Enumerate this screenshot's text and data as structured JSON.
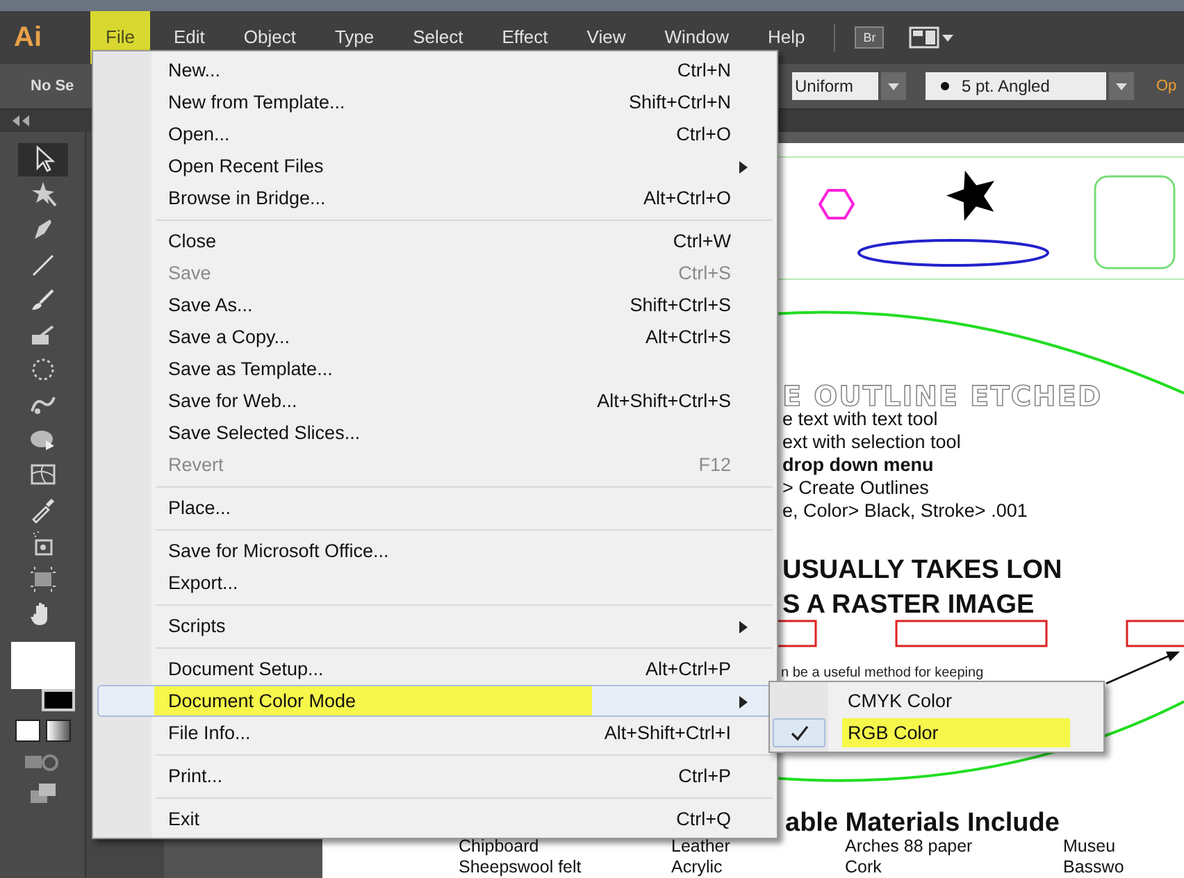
{
  "app": {
    "logo": "Ai"
  },
  "menubar": [
    {
      "label": "File",
      "selected": true
    },
    {
      "label": "Edit",
      "selected": false
    },
    {
      "label": "Object",
      "selected": false
    },
    {
      "label": "Type",
      "selected": false
    },
    {
      "label": "Select",
      "selected": false
    },
    {
      "label": "Effect",
      "selected": false
    },
    {
      "label": "View",
      "selected": false
    },
    {
      "label": "Window",
      "selected": false
    },
    {
      "label": "Help",
      "selected": false
    }
  ],
  "bridge_button": {
    "label": "Br"
  },
  "control_bar": {
    "selection": "No Se",
    "stroke_profile": "Uniform",
    "brush": "5 pt. Angled",
    "opacity_link": "Op"
  },
  "file_menu": {
    "groups": [
      [
        {
          "label": "New...",
          "shortcut": "Ctrl+N",
          "submenu": false,
          "disabled": false,
          "selected": false,
          "highlighted": false
        },
        {
          "label": "New from Template...",
          "shortcut": "Shift+Ctrl+N",
          "submenu": false,
          "disabled": false,
          "selected": false,
          "highlighted": false
        },
        {
          "label": "Open...",
          "shortcut": "Ctrl+O",
          "submenu": false,
          "disabled": false,
          "selected": false,
          "highlighted": false
        },
        {
          "label": "Open Recent Files",
          "submenu": true,
          "disabled": false,
          "selected": false,
          "highlighted": false
        },
        {
          "label": "Browse in Bridge...",
          "shortcut": "Alt+Ctrl+O",
          "submenu": false,
          "disabled": false,
          "selected": false,
          "highlighted": false
        }
      ],
      [
        {
          "label": "Close",
          "shortcut": "Ctrl+W",
          "submenu": false,
          "disabled": false,
          "selected": false,
          "highlighted": false
        },
        {
          "label": "Save",
          "shortcut": "Ctrl+S",
          "submenu": false,
          "disabled": true,
          "selected": false,
          "highlighted": false
        },
        {
          "label": "Save As...",
          "shortcut": "Shift+Ctrl+S",
          "submenu": false,
          "disabled": false,
          "selected": false,
          "highlighted": false
        },
        {
          "label": "Save a Copy...",
          "shortcut": "Alt+Ctrl+S",
          "submenu": false,
          "disabled": false,
          "selected": false,
          "highlighted": false
        },
        {
          "label": "Save as Template...",
          "submenu": false,
          "disabled": false,
          "selected": false,
          "highlighted": false
        },
        {
          "label": "Save for Web...",
          "shortcut": "Alt+Shift+Ctrl+S",
          "submenu": false,
          "disabled": false,
          "selected": false,
          "highlighted": false
        },
        {
          "label": "Save Selected Slices...",
          "submenu": false,
          "disabled": false,
          "selected": false,
          "highlighted": false
        },
        {
          "label": "Revert",
          "shortcut": "F12",
          "submenu": false,
          "disabled": true,
          "selected": false,
          "highlighted": false
        }
      ],
      [
        {
          "label": "Place...",
          "submenu": false,
          "disabled": false,
          "selected": false,
          "highlighted": false
        }
      ],
      [
        {
          "label": "Save for Microsoft Office...",
          "submenu": false,
          "disabled": false,
          "selected": false,
          "highlighted": false
        },
        {
          "label": "Export...",
          "submenu": false,
          "disabled": false,
          "selected": false,
          "highlighted": false
        }
      ],
      [
        {
          "label": "Scripts",
          "submenu": true,
          "disabled": false,
          "selected": false,
          "highlighted": false
        }
      ],
      [
        {
          "label": "Document Setup...",
          "shortcut": "Alt+Ctrl+P",
          "submenu": false,
          "disabled": false,
          "selected": false,
          "highlighted": false
        },
        {
          "label": "Document Color Mode",
          "submenu": true,
          "disabled": false,
          "selected": true,
          "highlighted": true
        },
        {
          "label": "File Info...",
          "shortcut": "Alt+Shift+Ctrl+I",
          "submenu": false,
          "disabled": false,
          "selected": false,
          "highlighted": false
        }
      ],
      [
        {
          "label": "Print...",
          "shortcut": "Ctrl+P",
          "submenu": false,
          "disabled": false,
          "selected": false,
          "highlighted": false
        }
      ],
      [
        {
          "label": "Exit",
          "shortcut": "Ctrl+Q",
          "submenu": false,
          "disabled": false,
          "selected": false,
          "highlighted": false
        }
      ]
    ]
  },
  "color_mode_submenu": [
    {
      "label": "CMYK Color",
      "checked": false,
      "highlighted": false
    },
    {
      "label": "RGB Color",
      "checked": true,
      "highlighted": true
    }
  ],
  "canvas": {
    "outline_heading": "E OUTLINE  ETCHED",
    "steps": [
      {
        "text": "e text with text tool",
        "bold": false
      },
      {
        "text": "ext with selection tool",
        "bold": false
      },
      {
        "text": "drop down menu",
        "bold": true
      },
      {
        "text": "> Create Outlines",
        "bold": false
      },
      {
        "text": "e, Color> Black, Stroke> .001",
        "bold": false
      }
    ],
    "headline": [
      "USUALLY TAKES  LON",
      "S A RASTER IMAGE"
    ],
    "note": "n be a useful method for keeping",
    "materials_heading": "able Materials Include",
    "materials": [
      [
        "Chipboard",
        "Leather",
        "Arches 88 paper",
        "Museu"
      ],
      [
        "Sheepswool felt",
        "Acrylic",
        "Cork",
        "Basswo"
      ]
    ]
  }
}
